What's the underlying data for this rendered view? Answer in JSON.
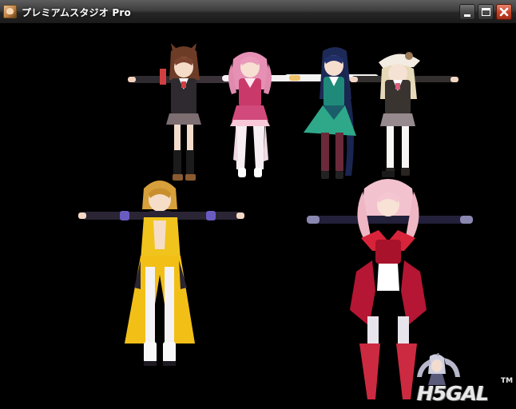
{
  "window": {
    "title": "プレミアムスタジオ Pro",
    "icon": "app-portrait-icon",
    "controls": [
      "minimize-icon",
      "maximize-icon",
      "close-icon"
    ]
  },
  "viewport": {
    "background": "#000000",
    "figures": [
      "figure-brown-hair-blazer",
      "figure-pink-twin-tails",
      "figure-navy-long-hair",
      "figure-cream-hair-white-hat",
      "figure-blonde-yellow-outfit",
      "figure-pink-hair-red-dress"
    ]
  },
  "watermark": {
    "text": "H5GAL",
    "trademark": "TM"
  },
  "colors": {
    "titlebar": "#2b2b2b",
    "close_button": "#c8452a",
    "title_text": "#ffffff"
  }
}
